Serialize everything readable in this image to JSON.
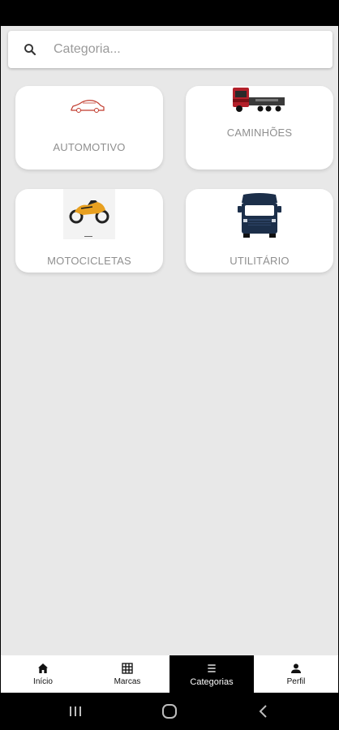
{
  "search": {
    "placeholder": "Categoria...",
    "icon": "search-icon"
  },
  "categories": [
    {
      "label": "AUTOMOTIVO",
      "icon": "car-icon"
    },
    {
      "label": "CAMINHÕES",
      "icon": "truck-icon"
    },
    {
      "label": "MOTOCICLETAS",
      "icon": "motorcycle-icon"
    },
    {
      "label": "UTILITÁRIO",
      "icon": "van-icon"
    }
  ],
  "bottom_nav": {
    "items": [
      {
        "label": "Início",
        "icon": "home-icon",
        "active": false
      },
      {
        "label": "Marcas",
        "icon": "grid-icon",
        "active": false
      },
      {
        "label": "Categorias",
        "icon": "list-icon",
        "active": true
      },
      {
        "label": "Perfil",
        "icon": "person-icon",
        "active": false
      }
    ]
  },
  "system_nav": [
    "recents-icon",
    "home-button-icon",
    "back-icon"
  ],
  "colors": {
    "background": "#e8e8e8",
    "card": "#ffffff",
    "label": "#8f8f8f",
    "active_nav": "#000000",
    "car_accent": "#c0392b",
    "moto_accent": "#e8a020",
    "van_accent": "#1c2f4a"
  }
}
